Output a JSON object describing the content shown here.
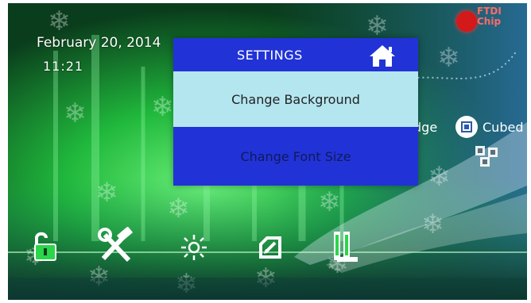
{
  "status": {
    "date": "February  20, 2014",
    "time": "11:21"
  },
  "logo": {
    "line1": "FTDI",
    "line2": "Chip",
    "color": "#d31919"
  },
  "background_labels": {
    "edge": "dge",
    "cubed": "Cubed"
  },
  "settings": {
    "title": "SETTINGS",
    "home_icon": "home-icon",
    "options": [
      "Change Background",
      "Change Font Size"
    ],
    "selected_option": "Change Background"
  },
  "dock": [
    "unlock-icon",
    "tools-icon",
    "brightness-icon",
    "edit-icon",
    "books-icon"
  ],
  "colors": {
    "panel": "#2133d6",
    "selected": "#b4e6f0",
    "accent": "#2cd64a"
  }
}
